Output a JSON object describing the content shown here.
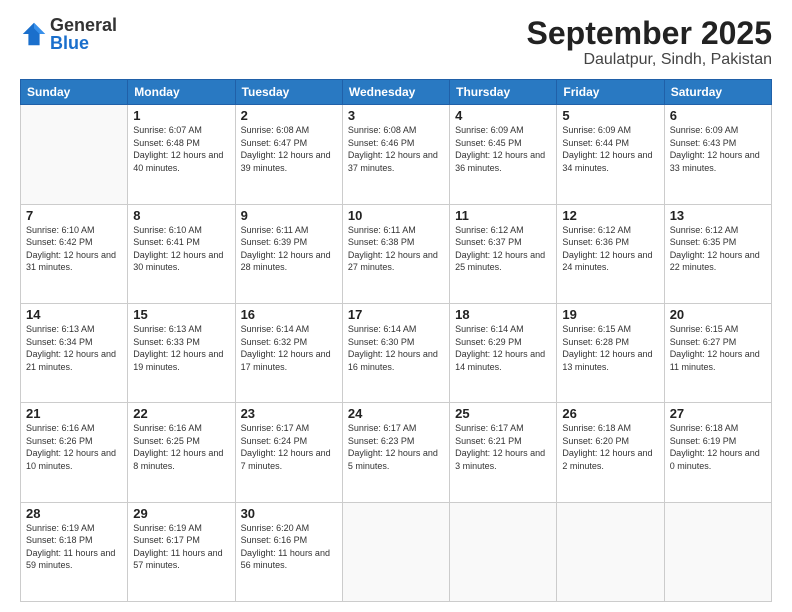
{
  "header": {
    "logo_general": "General",
    "logo_blue": "Blue",
    "month": "September 2025",
    "location": "Daulatpur, Sindh, Pakistan"
  },
  "weekdays": [
    "Sunday",
    "Monday",
    "Tuesday",
    "Wednesday",
    "Thursday",
    "Friday",
    "Saturday"
  ],
  "weeks": [
    [
      {
        "day": "",
        "info": ""
      },
      {
        "day": "1",
        "info": "Sunrise: 6:07 AM\nSunset: 6:48 PM\nDaylight: 12 hours\nand 40 minutes."
      },
      {
        "day": "2",
        "info": "Sunrise: 6:08 AM\nSunset: 6:47 PM\nDaylight: 12 hours\nand 39 minutes."
      },
      {
        "day": "3",
        "info": "Sunrise: 6:08 AM\nSunset: 6:46 PM\nDaylight: 12 hours\nand 37 minutes."
      },
      {
        "day": "4",
        "info": "Sunrise: 6:09 AM\nSunset: 6:45 PM\nDaylight: 12 hours\nand 36 minutes."
      },
      {
        "day": "5",
        "info": "Sunrise: 6:09 AM\nSunset: 6:44 PM\nDaylight: 12 hours\nand 34 minutes."
      },
      {
        "day": "6",
        "info": "Sunrise: 6:09 AM\nSunset: 6:43 PM\nDaylight: 12 hours\nand 33 minutes."
      }
    ],
    [
      {
        "day": "7",
        "info": "Sunrise: 6:10 AM\nSunset: 6:42 PM\nDaylight: 12 hours\nand 31 minutes."
      },
      {
        "day": "8",
        "info": "Sunrise: 6:10 AM\nSunset: 6:41 PM\nDaylight: 12 hours\nand 30 minutes."
      },
      {
        "day": "9",
        "info": "Sunrise: 6:11 AM\nSunset: 6:39 PM\nDaylight: 12 hours\nand 28 minutes."
      },
      {
        "day": "10",
        "info": "Sunrise: 6:11 AM\nSunset: 6:38 PM\nDaylight: 12 hours\nand 27 minutes."
      },
      {
        "day": "11",
        "info": "Sunrise: 6:12 AM\nSunset: 6:37 PM\nDaylight: 12 hours\nand 25 minutes."
      },
      {
        "day": "12",
        "info": "Sunrise: 6:12 AM\nSunset: 6:36 PM\nDaylight: 12 hours\nand 24 minutes."
      },
      {
        "day": "13",
        "info": "Sunrise: 6:12 AM\nSunset: 6:35 PM\nDaylight: 12 hours\nand 22 minutes."
      }
    ],
    [
      {
        "day": "14",
        "info": "Sunrise: 6:13 AM\nSunset: 6:34 PM\nDaylight: 12 hours\nand 21 minutes."
      },
      {
        "day": "15",
        "info": "Sunrise: 6:13 AM\nSunset: 6:33 PM\nDaylight: 12 hours\nand 19 minutes."
      },
      {
        "day": "16",
        "info": "Sunrise: 6:14 AM\nSunset: 6:32 PM\nDaylight: 12 hours\nand 17 minutes."
      },
      {
        "day": "17",
        "info": "Sunrise: 6:14 AM\nSunset: 6:30 PM\nDaylight: 12 hours\nand 16 minutes."
      },
      {
        "day": "18",
        "info": "Sunrise: 6:14 AM\nSunset: 6:29 PM\nDaylight: 12 hours\nand 14 minutes."
      },
      {
        "day": "19",
        "info": "Sunrise: 6:15 AM\nSunset: 6:28 PM\nDaylight: 12 hours\nand 13 minutes."
      },
      {
        "day": "20",
        "info": "Sunrise: 6:15 AM\nSunset: 6:27 PM\nDaylight: 12 hours\nand 11 minutes."
      }
    ],
    [
      {
        "day": "21",
        "info": "Sunrise: 6:16 AM\nSunset: 6:26 PM\nDaylight: 12 hours\nand 10 minutes."
      },
      {
        "day": "22",
        "info": "Sunrise: 6:16 AM\nSunset: 6:25 PM\nDaylight: 12 hours\nand 8 minutes."
      },
      {
        "day": "23",
        "info": "Sunrise: 6:17 AM\nSunset: 6:24 PM\nDaylight: 12 hours\nand 7 minutes."
      },
      {
        "day": "24",
        "info": "Sunrise: 6:17 AM\nSunset: 6:23 PM\nDaylight: 12 hours\nand 5 minutes."
      },
      {
        "day": "25",
        "info": "Sunrise: 6:17 AM\nSunset: 6:21 PM\nDaylight: 12 hours\nand 3 minutes."
      },
      {
        "day": "26",
        "info": "Sunrise: 6:18 AM\nSunset: 6:20 PM\nDaylight: 12 hours\nand 2 minutes."
      },
      {
        "day": "27",
        "info": "Sunrise: 6:18 AM\nSunset: 6:19 PM\nDaylight: 12 hours\nand 0 minutes."
      }
    ],
    [
      {
        "day": "28",
        "info": "Sunrise: 6:19 AM\nSunset: 6:18 PM\nDaylight: 11 hours\nand 59 minutes."
      },
      {
        "day": "29",
        "info": "Sunrise: 6:19 AM\nSunset: 6:17 PM\nDaylight: 11 hours\nand 57 minutes."
      },
      {
        "day": "30",
        "info": "Sunrise: 6:20 AM\nSunset: 6:16 PM\nDaylight: 11 hours\nand 56 minutes."
      },
      {
        "day": "",
        "info": ""
      },
      {
        "day": "",
        "info": ""
      },
      {
        "day": "",
        "info": ""
      },
      {
        "day": "",
        "info": ""
      }
    ]
  ]
}
